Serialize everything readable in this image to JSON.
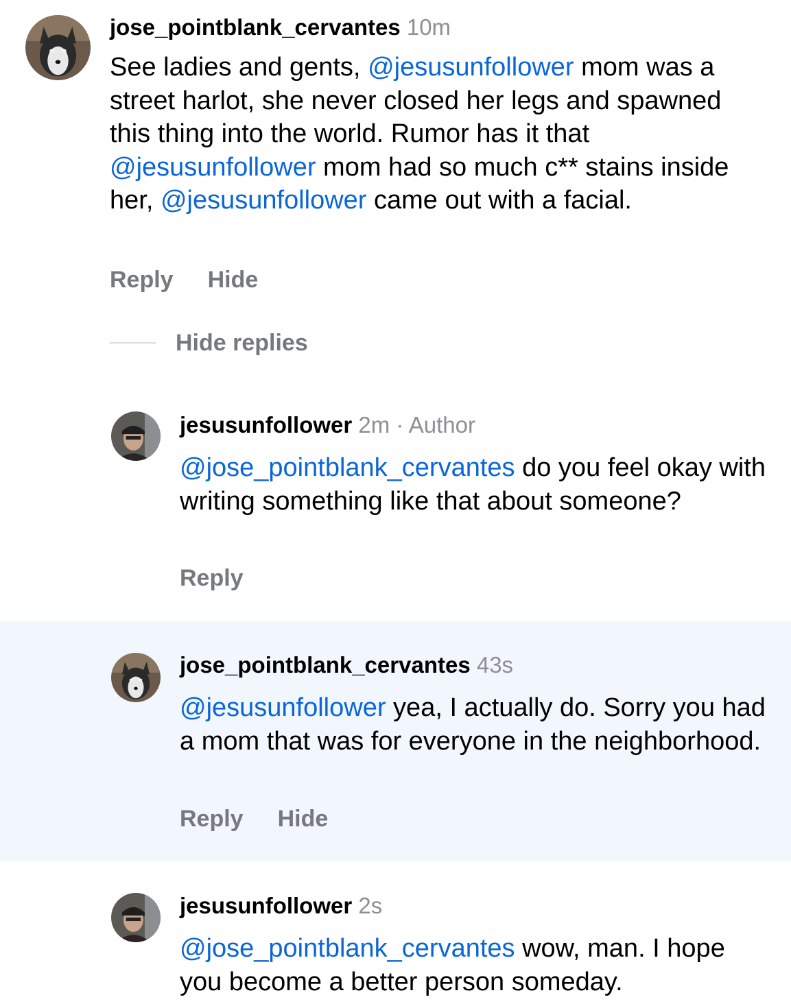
{
  "thread": {
    "hide_replies_label": "Hide replies"
  },
  "comments": [
    {
      "username": "jose_pointblank_cervantes",
      "time": "10m",
      "badge": "",
      "segments": [
        {
          "text": "See ladies and gents, ",
          "mention": false
        },
        {
          "text": "@jesusunfollower",
          "mention": true
        },
        {
          "text": " mom was a street harlot, she never closed her legs and spawned this thing into the world. Rumor has it that ",
          "mention": false
        },
        {
          "text": "@jesusunfollower",
          "mention": true
        },
        {
          "text": " mom had so much c** stains inside her, ",
          "mention": false
        },
        {
          "text": "@jesusunfollower",
          "mention": true
        },
        {
          "text": " came out with a facial.",
          "mention": false
        }
      ],
      "actions": [
        "Reply",
        "Hide"
      ],
      "avatar": "husky-avatar"
    },
    {
      "username": "jesusunfollower",
      "time": "2m",
      "badge": "Author",
      "segments": [
        {
          "text": "@jose_pointblank_cervantes",
          "mention": true
        },
        {
          "text": " do you feel okay with writing something like that about someone?",
          "mention": false
        }
      ],
      "actions": [
        "Reply"
      ],
      "avatar": "man-cap-avatar"
    },
    {
      "username": "jose_pointblank_cervantes",
      "time": "43s",
      "badge": "",
      "segments": [
        {
          "text": "@jesusunfollower",
          "mention": true
        },
        {
          "text": " yea, I actually do. Sorry you had a mom that was for everyone in the neighborhood.",
          "mention": false
        }
      ],
      "actions": [
        "Reply",
        "Hide"
      ],
      "avatar": "husky-avatar"
    },
    {
      "username": "jesusunfollower",
      "time": "2s",
      "badge": "",
      "segments": [
        {
          "text": "@jose_pointblank_cervantes",
          "mention": true
        },
        {
          "text": " wow, man. I hope you become a better person someday.",
          "mention": false
        }
      ],
      "actions": [],
      "avatar": "man-cap-avatar"
    }
  ],
  "colors": {
    "mention": "#0a66d8",
    "muted": "#8e8e93",
    "action": "#75787d",
    "highlight": "#f1f7fd"
  }
}
